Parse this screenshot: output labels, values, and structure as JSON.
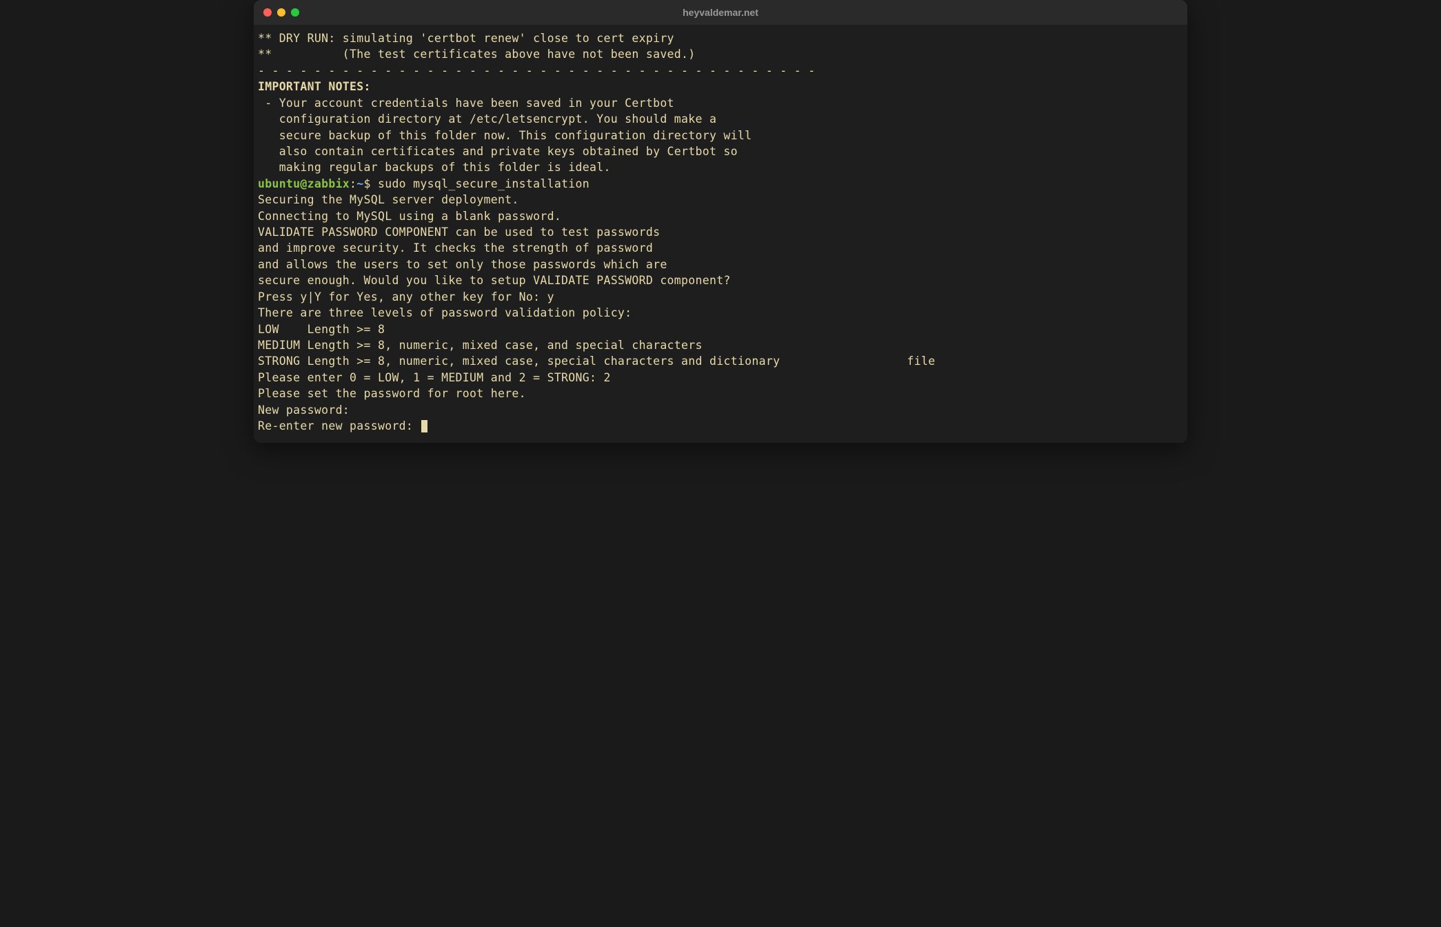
{
  "title": "heyvaldemar.net",
  "lines": {
    "l1": "** DRY RUN: simulating 'certbot renew' close to cert expiry",
    "l2": "**          (The test certificates above have not been saved.)",
    "l3": "- - - - - - - - - - - - - - - - - - - - - - - - - - - - - - - - - - - - - - - -",
    "l4": "",
    "l5": "IMPORTANT NOTES:",
    "l6": " - Your account credentials have been saved in your Certbot",
    "l7": "   configuration directory at /etc/letsencrypt. You should make a",
    "l8": "   secure backup of this folder now. This configuration directory will",
    "l9": "   also contain certificates and private keys obtained by Certbot so",
    "l10": "   making regular backups of this folder is ideal.",
    "prompt_user": "ubuntu@zabbix",
    "prompt_colon": ":",
    "prompt_path": "~",
    "prompt_dollar": "$ ",
    "cmd": "sudo mysql_secure_installation",
    "l12": "",
    "l13": "Securing the MySQL server deployment.",
    "l14": "",
    "l15": "Connecting to MySQL using a blank password.",
    "l16": "",
    "l17": "VALIDATE PASSWORD COMPONENT can be used to test passwords",
    "l18": "and improve security. It checks the strength of password",
    "l19": "and allows the users to set only those passwords which are",
    "l20": "secure enough. Would you like to setup VALIDATE PASSWORD component?",
    "l21": "",
    "l22": "Press y|Y for Yes, any other key for No: y",
    "l23": "",
    "l24": "There are three levels of password validation policy:",
    "l25": "",
    "l26": "LOW    Length >= 8",
    "l27": "MEDIUM Length >= 8, numeric, mixed case, and special characters",
    "l28": "STRONG Length >= 8, numeric, mixed case, special characters and dictionary                  file",
    "l29": "",
    "l30": "Please enter 0 = LOW, 1 = MEDIUM and 2 = STRONG: 2",
    "l31": "Please set the password for root here.",
    "l32": "",
    "l33": "New password:",
    "l34": "",
    "l35": "Re-enter new password: "
  }
}
